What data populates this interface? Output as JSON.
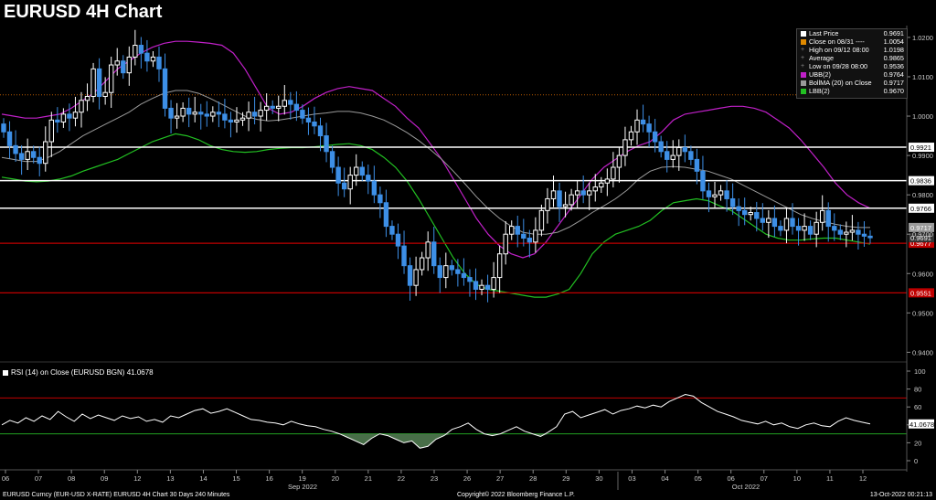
{
  "title": "EURUSD 4H Chart",
  "colors": {
    "background": "#000000",
    "up_candle": "#ffffff",
    "down_candle": "#3d8fe6",
    "upper_band": "#c020c8",
    "middle_band": "#9a9a9a",
    "lower_band": "#22c022",
    "support_line": "#c00000",
    "resistance_line": "#ffffff",
    "high_line": "#b85a00",
    "rsi_line": "#ffffff",
    "rsi_fill": "#5a8a5a",
    "rsi_upper": "#c00000",
    "rsi_lower": "#22a022"
  },
  "legend": [
    {
      "label": "Last Price",
      "value": "0.9691",
      "color": "#ffffff",
      "icon": "square"
    },
    {
      "label": "Close on 08/31  ----",
      "value": "1.0054",
      "color": "#e08a00",
      "icon": "square"
    },
    {
      "label": "High on 09/12 08:00",
      "value": "1.0198",
      "color": "#888888",
      "icon": "plus"
    },
    {
      "label": "Average",
      "value": "0.9865",
      "color": "#888888",
      "icon": "plus"
    },
    {
      "label": "Low on 09/28 08:00",
      "value": "0.9536",
      "color": "#888888",
      "icon": "plus"
    },
    {
      "label": "UBB(2)",
      "value": "0.9764",
      "color": "#c020c8",
      "icon": "square"
    },
    {
      "label": "BollMA (20)  on Close",
      "value": "0.9717",
      "color": "#9a9a9a",
      "icon": "square"
    },
    {
      "label": "LBB(2)",
      "value": "0.9670",
      "color": "#22c022",
      "icon": "square"
    }
  ],
  "rsi_legend": "RSI (14)  on Close (EURUSD BGN)  41.0678",
  "footer": {
    "left": "EURUSD Curncy (EUR-USD X-RATE) EURUSD 4H Chart 30 Days 240 Minutes",
    "center": "Copyright© 2022 Bloomberg Finance L.P.",
    "right": "13-Oct-2022 00:21:13"
  },
  "chart_data": {
    "type": "candlestick",
    "title": "EURUSD 4H Chart",
    "y_ticks": [
      "1.0200",
      "1.0100",
      "1.0000",
      "0.9900",
      "0.9800",
      "0.9700",
      "0.9600",
      "0.9500",
      "0.9400"
    ],
    "ylim": [
      0.938,
      1.023
    ],
    "x_tick_labels": [
      "06",
      "07",
      "08",
      "09",
      "12",
      "13",
      "14",
      "15",
      "16",
      "19",
      "20",
      "21",
      "22",
      "23",
      "26",
      "27",
      "28",
      "29",
      "30",
      "03",
      "04",
      "05",
      "06",
      "07",
      "10",
      "11",
      "12"
    ],
    "month_labels": [
      "Sep 2022",
      "Oct 2022"
    ],
    "horizontal_levels": [
      {
        "label": "0.9921",
        "value": 0.9921,
        "kind": "resistance"
      },
      {
        "label": "0.9836",
        "value": 0.9836,
        "kind": "resistance"
      },
      {
        "label": "0.9766",
        "value": 0.9766,
        "kind": "resistance"
      },
      {
        "label": "0.9677",
        "value": 0.9677,
        "kind": "support"
      },
      {
        "label": "0.9551",
        "value": 0.9551,
        "kind": "support"
      }
    ],
    "high_reference": 1.0054,
    "axis_tags": [
      {
        "label": "0.9717",
        "value": 0.9717,
        "kind": "ma"
      },
      {
        "label": "0.9691",
        "value": 0.9691,
        "kind": "last"
      }
    ],
    "close": [
      0.996,
      0.9925,
      0.9905,
      0.989,
      0.991,
      0.9895,
      0.988,
      0.9935,
      0.999,
      0.9985,
      1.0005,
      0.9995,
      1.001,
      1.004,
      1.005,
      1.012,
      1.005,
      1.006,
      1.013,
      1.014,
      1.011,
      1.015,
      1.018,
      1.016,
      1.014,
      1.015,
      1.012,
      1.002,
      0.9995,
      1.0,
      1.002,
      1.0005,
      1.001,
      1.0005,
      1.0,
      1.001,
      1.0005,
      0.999,
      0.9985,
      0.999,
      0.9995,
      1.001,
      1.0,
      1.0015,
      1.0025,
      1.002,
      1.0025,
      1.004,
      1.003,
      1.0015,
      0.9995,
      0.9985,
      0.9975,
      0.995,
      0.991,
      0.987,
      0.983,
      0.9815,
      0.985,
      0.987,
      0.985,
      0.9835,
      0.98,
      0.978,
      0.972,
      0.97,
      0.967,
      0.962,
      0.957,
      0.961,
      0.964,
      0.968,
      0.962,
      0.959,
      0.962,
      0.961,
      0.96,
      0.959,
      0.958,
      0.956,
      0.957,
      0.956,
      0.959,
      0.965,
      0.97,
      0.972,
      0.97,
      0.969,
      0.968,
      0.971,
      0.976,
      0.979,
      0.981,
      0.977,
      0.9775,
      0.98,
      0.981,
      0.98,
      0.981,
      0.982,
      0.983,
      0.984,
      0.987,
      0.99,
      0.994,
      0.996,
      0.999,
      0.998,
      0.996,
      0.9935,
      0.991,
      0.989,
      0.99,
      0.992,
      0.991,
      0.989,
      0.986,
      0.981,
      0.9795,
      0.98,
      0.981,
      0.979,
      0.977,
      0.976,
      0.975,
      0.9755,
      0.974,
      0.973,
      0.974,
      0.972,
      0.971,
      0.974,
      0.972,
      0.971,
      0.972,
      0.97,
      0.973,
      0.976,
      0.972,
      0.971,
      0.97,
      0.9705,
      0.971,
      0.97,
      0.9695,
      0.9691
    ],
    "upper_band": [
      1.0005,
      1.0,
      0.9995,
      0.9995,
      1.0,
      1.0005,
      1.002,
      1.004,
      1.006,
      1.009,
      1.012,
      1.014,
      1.016,
      1.0175,
      1.0185,
      1.019,
      1.019,
      1.0188,
      1.0185,
      1.018,
      1.016,
      1.012,
      1.007,
      1.002,
      1.0005,
      1.001,
      1.0025,
      1.0045,
      1.006,
      1.007,
      1.0075,
      1.007,
      1.0065,
      1.0045,
      1.0025,
      0.9995,
      0.997,
      0.993,
      0.989,
      0.984,
      0.979,
      0.974,
      0.97,
      0.967,
      0.965,
      0.964,
      0.965,
      0.968,
      0.972,
      0.976,
      0.98,
      0.984,
      0.987,
      0.989,
      0.991,
      0.9925,
      0.9935,
      0.996,
      0.999,
      1.0005,
      1.001,
      1.0015,
      1.002,
      1.0025,
      1.0025,
      1.002,
      1.001,
      0.999,
      0.997,
      0.994,
      0.9905,
      0.987,
      0.983,
      0.98,
      0.978,
      0.9766
    ],
    "middle_band": [
      0.9895,
      0.989,
      0.9885,
      0.9885,
      0.9895,
      0.991,
      0.993,
      0.995,
      0.9965,
      0.998,
      0.9995,
      1.001,
      1.003,
      1.0045,
      1.0058,
      1.0065,
      1.0065,
      1.0058,
      1.0045,
      1.003,
      1.0015,
      1.0,
      0.9992,
      0.9988,
      0.999,
      0.9995,
      1.0,
      1.0005,
      1.0008,
      1.0012,
      1.0012,
      1.0008,
      1.0,
      0.999,
      0.9975,
      0.9958,
      0.9938,
      0.9915,
      0.989,
      0.986,
      0.9828,
      0.9795,
      0.9765,
      0.974,
      0.972,
      0.9705,
      0.97,
      0.97,
      0.9705,
      0.9718,
      0.9735,
      0.9755,
      0.9772,
      0.979,
      0.9812,
      0.984,
      0.986,
      0.987,
      0.9872,
      0.987,
      0.9865,
      0.986,
      0.985,
      0.984,
      0.9825,
      0.981,
      0.9795,
      0.978,
      0.9765,
      0.975,
      0.974,
      0.9732,
      0.9725,
      0.972,
      0.9717,
      0.9717
    ],
    "lower_band": [
      0.9845,
      0.984,
      0.9835,
      0.9833,
      0.9835,
      0.984,
      0.9848,
      0.986,
      0.987,
      0.988,
      0.989,
      0.9905,
      0.992,
      0.9935,
      0.9945,
      0.9955,
      0.995,
      0.994,
      0.9925,
      0.9915,
      0.991,
      0.9908,
      0.991,
      0.9915,
      0.9918,
      0.992,
      0.992,
      0.9922,
      0.9925,
      0.9928,
      0.993,
      0.9925,
      0.9915,
      0.9895,
      0.987,
      0.9835,
      0.979,
      0.974,
      0.969,
      0.964,
      0.96,
      0.9572,
      0.956,
      0.9555,
      0.955,
      0.9545,
      0.954,
      0.954,
      0.9548,
      0.956,
      0.96,
      0.965,
      0.968,
      0.97,
      0.971,
      0.972,
      0.9735,
      0.976,
      0.978,
      0.9785,
      0.979,
      0.9785,
      0.9772,
      0.976,
      0.974,
      0.972,
      0.97,
      0.969,
      0.9685,
      0.9685,
      0.9688,
      0.969,
      0.969,
      0.9685,
      0.968,
      0.9675
    ],
    "rsi": {
      "label": "RSI (14)",
      "last": "41.0678",
      "ylim": [
        0,
        100
      ],
      "y_ticks": [
        "100",
        "80",
        "60",
        "40",
        "20",
        "0"
      ],
      "upper": 70,
      "lower": 30,
      "values": [
        40,
        45,
        42,
        48,
        44,
        50,
        46,
        55,
        49,
        44,
        52,
        47,
        51,
        48,
        45,
        50,
        47,
        49,
        44,
        46,
        43,
        50,
        48,
        52,
        56,
        58,
        53,
        55,
        58,
        54,
        50,
        46,
        45,
        43,
        42,
        40,
        44,
        41,
        39,
        38,
        35,
        33,
        30,
        26,
        22,
        18,
        25,
        30,
        28,
        24,
        20,
        22,
        14,
        16,
        24,
        28,
        35,
        38,
        42,
        35,
        30,
        28,
        30,
        34,
        38,
        33,
        30,
        27,
        32,
        38,
        52,
        55,
        48,
        51,
        54,
        57,
        52,
        56,
        58,
        61,
        59,
        62,
        60,
        66,
        70,
        74,
        72,
        65,
        60,
        55,
        52,
        49,
        45,
        43,
        41,
        44,
        40,
        42,
        38,
        36,
        40,
        42,
        39,
        38,
        44,
        48,
        45,
        43,
        41
      ]
    }
  }
}
